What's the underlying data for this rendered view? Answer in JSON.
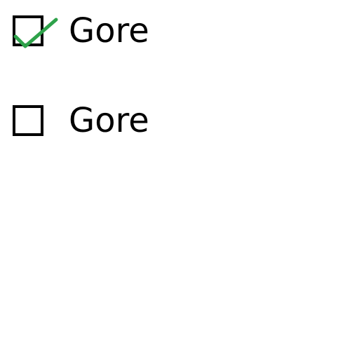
{
  "options": [
    {
      "label": "Gore",
      "checked": true
    },
    {
      "label": "Gore",
      "checked": false
    }
  ],
  "colors": {
    "check": "#2ea24a",
    "box_border": "#000000",
    "text": "#000000",
    "background": "#ffffff"
  },
  "icons": {
    "checked": "check-icon"
  }
}
